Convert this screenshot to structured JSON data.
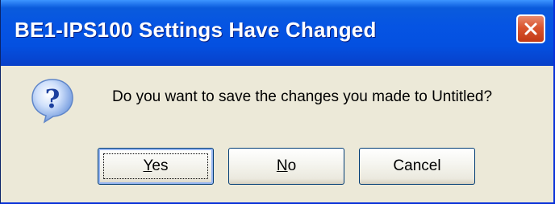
{
  "window": {
    "title": "BE1-IPS100 Settings Have Changed"
  },
  "icons": {
    "question": "question-icon",
    "close": "close-icon"
  },
  "colors": {
    "titlebar": "#0554e3",
    "close_button": "#d9542e",
    "dialog_background": "#ece9d8"
  },
  "message": {
    "text": "Do you want to save the changes you made to Untitled?"
  },
  "buttons": {
    "yes": {
      "accel": "Y",
      "rest": "es"
    },
    "no": {
      "accel": "N",
      "rest": "o"
    },
    "cancel": {
      "label": "Cancel"
    }
  }
}
